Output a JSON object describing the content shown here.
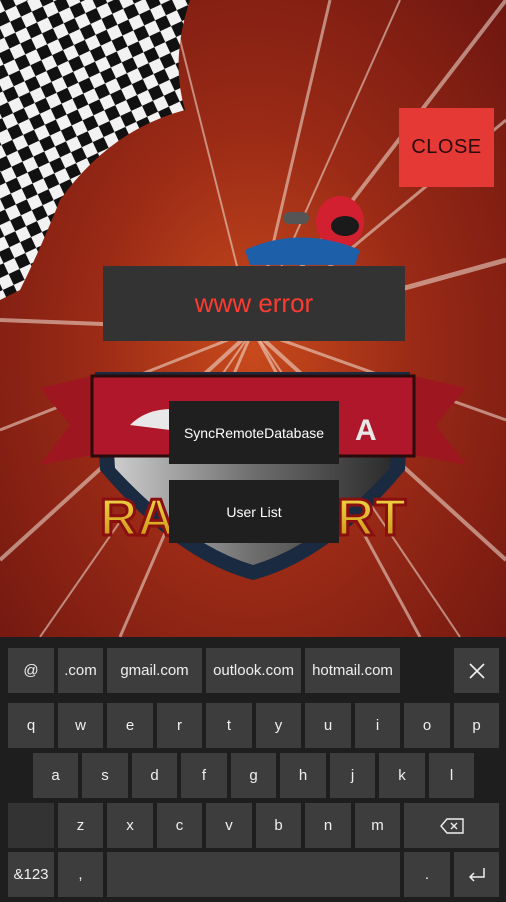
{
  "overlay": {
    "close_label": "CLOSE",
    "error_text": "www error",
    "sync_label": "SyncRemoteDatabase",
    "user_list_label": "User List"
  },
  "background": {
    "banner_text": "RACE KART",
    "brand_fragment": "A"
  },
  "keyboard": {
    "suggestion_row": [
      "@",
      ".com",
      "gmail.com",
      "outlook.com",
      "hotmail.com"
    ],
    "row1": [
      "q",
      "w",
      "e",
      "r",
      "t",
      "y",
      "u",
      "i",
      "o",
      "p"
    ],
    "row2": [
      "a",
      "s",
      "d",
      "f",
      "g",
      "h",
      "j",
      "k",
      "l"
    ],
    "row3": [
      "z",
      "x",
      "c",
      "v",
      "b",
      "n",
      "m"
    ],
    "symbols_label": "&123",
    "comma_label": ",",
    "period_label": ".",
    "icons": [
      "close-icon",
      "backspace-icon",
      "enter-icon"
    ]
  },
  "colors": {
    "close_button": "#e53935",
    "error_text": "#ff3b30",
    "key_background": "#3d3d3d",
    "keyboard_background": "#1e1e1e"
  }
}
